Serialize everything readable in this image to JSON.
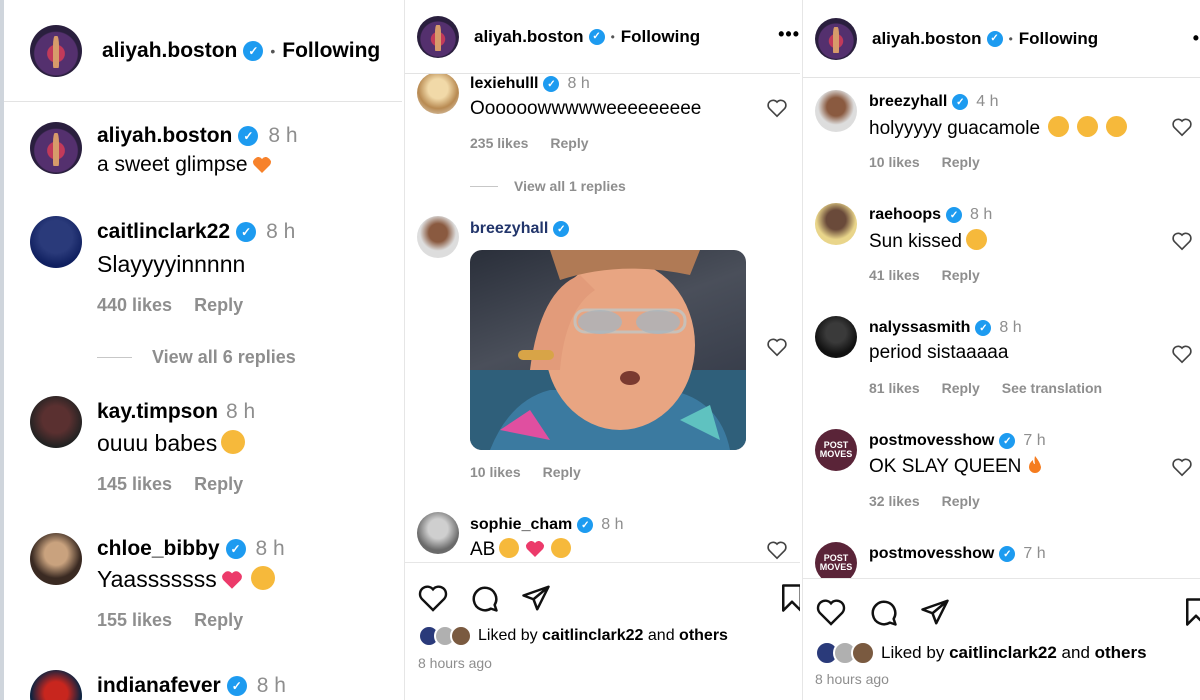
{
  "panel1": {
    "header": {
      "username": "aliyah.boston",
      "separator": "•",
      "follow_label": "Following"
    },
    "comments": [
      {
        "username": "aliyah.boston",
        "time": "8 h",
        "text": "a sweet glimpse"
      },
      {
        "username": "caitlinclark22",
        "time": "8 h",
        "text": "Slayyyyinnnnn",
        "likes": "440 likes",
        "reply": "Reply",
        "view_replies": "View all 6 replies"
      },
      {
        "username": "kay.timpson",
        "time": "8 h",
        "text": "ouuu babes",
        "likes": "145 likes",
        "reply": "Reply"
      },
      {
        "username": "chloe_bibby",
        "time": "8 h",
        "text": "Yaasssssss",
        "likes": "155 likes",
        "reply": "Reply"
      },
      {
        "username": "indianafever",
        "time": "8 h"
      }
    ]
  },
  "panel2": {
    "header": {
      "username": "aliyah.boston",
      "separator": "•",
      "follow_label": "Following",
      "more": "•••"
    },
    "comments": [
      {
        "username": "lexiehulll",
        "time": "8 h",
        "text": "Oooooowwwwweeeeeeeee",
        "likes": "235 likes",
        "reply": "Reply",
        "view_replies": "View all 1 replies"
      },
      {
        "username": "breezyhall",
        "likes": "10 likes",
        "reply": "Reply"
      },
      {
        "username": "sophie_cham",
        "time": "8 h",
        "text": "AB"
      }
    ],
    "liked_by": {
      "prefix": "Liked by ",
      "user": "caitlinclark22",
      "middle": " and ",
      "suffix": "others"
    },
    "time_ago": "8 hours ago"
  },
  "panel3": {
    "header": {
      "username": "aliyah.boston",
      "separator": "•",
      "follow_label": "Following",
      "more": "•"
    },
    "comments": [
      {
        "username": "breezyhall",
        "time": "4 h",
        "text": "holyyyyy guacamole",
        "likes": "10 likes",
        "reply": "Reply"
      },
      {
        "username": "raehoops",
        "time": "8 h",
        "text": "Sun kissed",
        "likes": "41 likes",
        "reply": "Reply"
      },
      {
        "username": "nalyssasmith",
        "time": "8 h",
        "text": "period sistaaaaa",
        "likes": "81 likes",
        "reply": "Reply",
        "translate": "See translation"
      },
      {
        "username": "postmovesshow",
        "time": "7 h",
        "text": "OK SLAY QUEEN",
        "likes": "32 likes",
        "reply": "Reply",
        "avatar_text": "POST MOVES"
      },
      {
        "username": "postmovesshow",
        "time": "7 h",
        "avatar_text": "POST MOVES"
      }
    ],
    "liked_by": {
      "prefix": "Liked by ",
      "user": "caitlinclark22",
      "middle": " and ",
      "suffix": "others"
    },
    "time_ago": "8 hours ago"
  },
  "colors": {
    "verified": "#1d9bf0",
    "meta_gray": "#8e8e8e",
    "heart_red": "#e0245e",
    "emoji_yellow": "#f6b93b"
  },
  "icons": [
    "heart-icon",
    "comment-icon",
    "share-icon",
    "bookmark-icon",
    "verified-icon",
    "more-icon"
  ]
}
